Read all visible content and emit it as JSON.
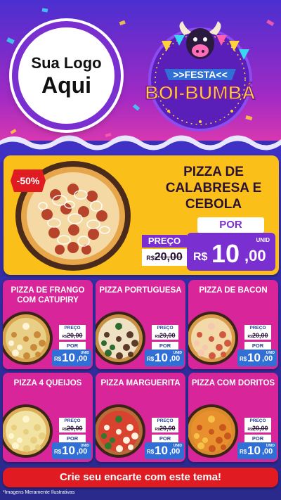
{
  "logo": {
    "line1": "Sua Logo",
    "line2": "Aqui"
  },
  "festa": {
    "line1": ">>FESTA<<",
    "line2": "BOI-BUMBÁ"
  },
  "featured": {
    "badge": "-50%",
    "title": "PIZZA DE CALABRESA E CEBOLA",
    "preco_label": "PREÇO",
    "old_currency": "R$",
    "old_amount": "20,00",
    "por_label": "POR",
    "unid_label": "UNID",
    "new_currency": "R$",
    "new_amount": "10",
    "new_cents": ",00"
  },
  "products": [
    {
      "title": "PIZZA DE FRANGO COM CATUPIRY",
      "preco_label": "PREÇO",
      "old_currency": "R$",
      "old_amount": "20,00",
      "por_label": "POR",
      "unid_label": "UNID",
      "new_currency": "R$",
      "new_amount": "10",
      "new_cents": ",00",
      "pizza": "frango"
    },
    {
      "title": "PIZZA PORTUGUESA",
      "preco_label": "PREÇO",
      "old_currency": "R$",
      "old_amount": "20,00",
      "por_label": "POR",
      "unid_label": "UNID",
      "new_currency": "R$",
      "new_amount": "10",
      "new_cents": ",00",
      "pizza": "portuguesa"
    },
    {
      "title": "PIZZA DE BACON",
      "preco_label": "PREÇO",
      "old_currency": "R$",
      "old_amount": "20,00",
      "por_label": "POR",
      "unid_label": "UNID",
      "new_currency": "R$",
      "new_amount": "10",
      "new_cents": ",00",
      "pizza": "bacon"
    },
    {
      "title": "PIZZA 4 QUEIJOS",
      "preco_label": "PREÇO",
      "old_currency": "R$",
      "old_amount": "20,00",
      "por_label": "POR",
      "unid_label": "UNID",
      "new_currency": "R$",
      "new_amount": "10",
      "new_cents": ",00",
      "pizza": "queijos"
    },
    {
      "title": "PIZZA MARGUERITA",
      "preco_label": "PREÇO",
      "old_currency": "R$",
      "old_amount": "20,00",
      "por_label": "POR",
      "unid_label": "UNID",
      "new_currency": "R$",
      "new_amount": "10",
      "new_cents": ",00",
      "pizza": "marguerita"
    },
    {
      "title": "PIZZA COM DORITOS",
      "preco_label": "PREÇO",
      "old_currency": "R$",
      "old_amount": "20,00",
      "por_label": "POR",
      "unid_label": "UNID",
      "new_currency": "R$",
      "new_amount": "10",
      "new_cents": ",00",
      "pizza": "doritos"
    }
  ],
  "cta": {
    "label": "Crie seu encarte com este tema!"
  },
  "disclaimer": "*Imagens Meramente Ilustrativas",
  "colors": {
    "card_pink": "#d8269a",
    "featured_yellow": "#fbbf1a",
    "purple": "#7a2fd1",
    "price_blue": "#2f6fd6",
    "cta_red": "#e01b22"
  }
}
